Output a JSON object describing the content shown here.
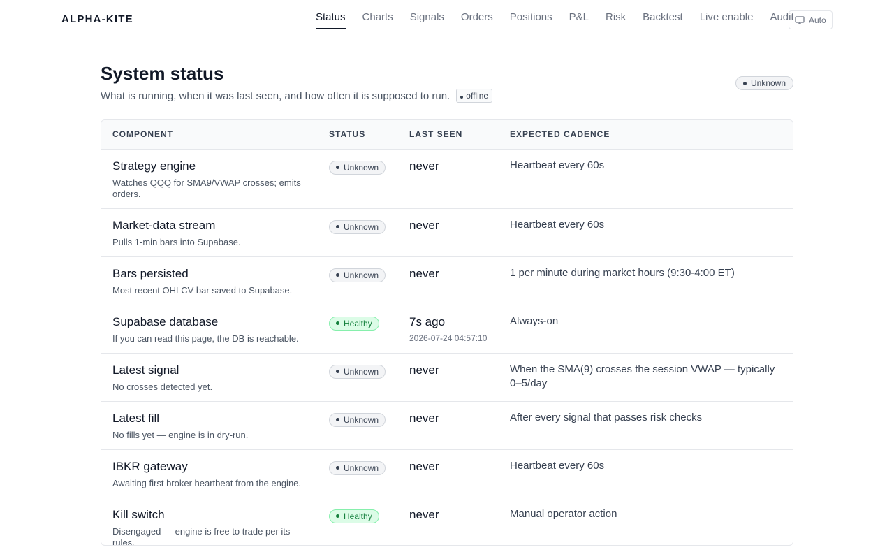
{
  "app": {
    "brand": "ALPHA-KITE"
  },
  "nav": {
    "items": [
      "Status",
      "Charts",
      "Signals",
      "Orders",
      "Positions",
      "P&L",
      "Risk",
      "Backtest",
      "Live enable",
      "Audit"
    ],
    "active": "Status",
    "theme_label": "Auto",
    "theme_icon": "monitor-icon"
  },
  "page": {
    "title": "System status",
    "subtitle": "What is running, when it was last seen, and how often it is supposed to run.",
    "connection_tag": "offline",
    "overall_status": "Unknown"
  },
  "table": {
    "headers": {
      "component": "COMPONENT",
      "status": "STATUS",
      "last_seen": "LAST SEEN",
      "cadence": "EXPECTED CADENCE"
    },
    "rows": [
      {
        "name": "Strategy engine",
        "desc": "Watches QQQ for SMA9/VWAP crosses; emits orders.",
        "status": "Unknown",
        "last_seen": "never",
        "last_seen_sub": "",
        "cadence": "Heartbeat every 60s"
      },
      {
        "name": "Market-data stream",
        "desc": "Pulls 1-min bars into Supabase.",
        "status": "Unknown",
        "last_seen": "never",
        "last_seen_sub": "",
        "cadence": "Heartbeat every 60s"
      },
      {
        "name": "Bars persisted",
        "desc": "Most recent OHLCV bar saved to Supabase.",
        "status": "Unknown",
        "last_seen": "never",
        "last_seen_sub": "",
        "cadence": "1 per minute during market hours (9:30-4:00 ET)"
      },
      {
        "name": "Supabase database",
        "desc": "If you can read this page, the DB is reachable.",
        "status": "Healthy",
        "last_seen": "7s ago",
        "last_seen_sub": "2026-07-24 04:57:10",
        "cadence": "Always-on"
      },
      {
        "name": "Latest signal",
        "desc": "No crosses detected yet.",
        "status": "Unknown",
        "last_seen": "never",
        "last_seen_sub": "",
        "cadence": "When the SMA(9) crosses the session VWAP — typically 0–5/day"
      },
      {
        "name": "Latest fill",
        "desc": "No fills yet — engine is in dry-run.",
        "status": "Unknown",
        "last_seen": "never",
        "last_seen_sub": "",
        "cadence": "After every signal that passes risk checks"
      },
      {
        "name": "IBKR gateway",
        "desc": "Awaiting first broker heartbeat from the engine.",
        "status": "Unknown",
        "last_seen": "never",
        "last_seen_sub": "",
        "cadence": "Heartbeat every 60s"
      },
      {
        "name": "Kill switch",
        "desc": "Disengaged — engine is free to trade per its rules.",
        "status": "Healthy",
        "last_seen": "never",
        "last_seen_sub": "",
        "cadence": "Manual operator action"
      }
    ]
  },
  "colors": {
    "healthy": "#15803d",
    "unknown": "#374151",
    "accent": "#111827"
  }
}
